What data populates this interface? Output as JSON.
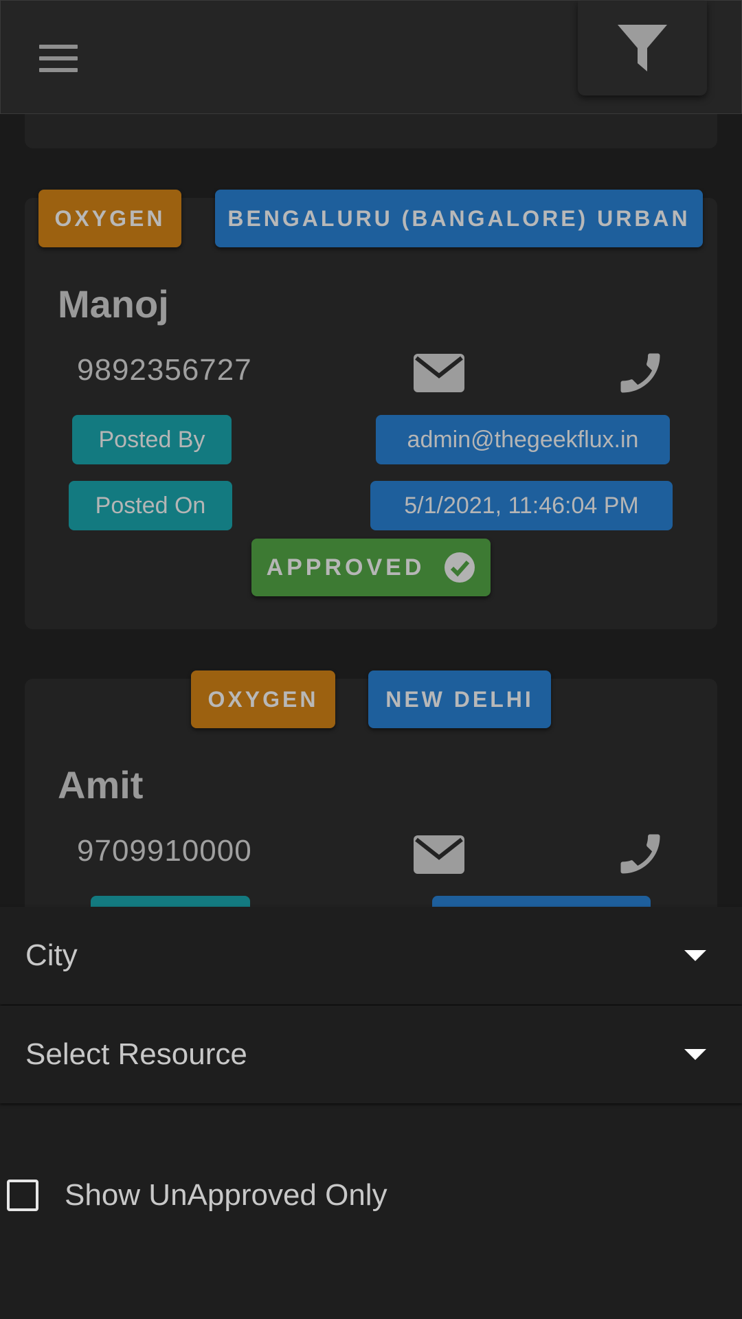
{
  "appbar": {
    "menu_icon": "hamburger-menu-icon",
    "filter_icon": "funnel-filter-icon"
  },
  "posts": [
    {
      "resource": "OXYGEN",
      "city": "BENGALURU (BANGALORE) URBAN",
      "name": "Manoj",
      "phone": "9892356727",
      "posted_by_label": "Posted By",
      "posted_by": "admin@thegeekflux.in",
      "posted_on_label": "Posted On",
      "posted_on": "5/1/2021, 11:46:04 PM",
      "status": "APPROVED"
    },
    {
      "resource": "OXYGEN",
      "city": "NEW DELHI",
      "name": "Amit",
      "phone": "9709910000"
    }
  ],
  "filters": {
    "city_label": "City",
    "resource_label": "Select Resource",
    "unapproved_label": "Show UnApproved Only"
  },
  "colors": {
    "resource_chip": "#9c6110",
    "city_chip": "#1e5f9c",
    "label_pill": "#137a80",
    "approved": "#3d7a33"
  }
}
